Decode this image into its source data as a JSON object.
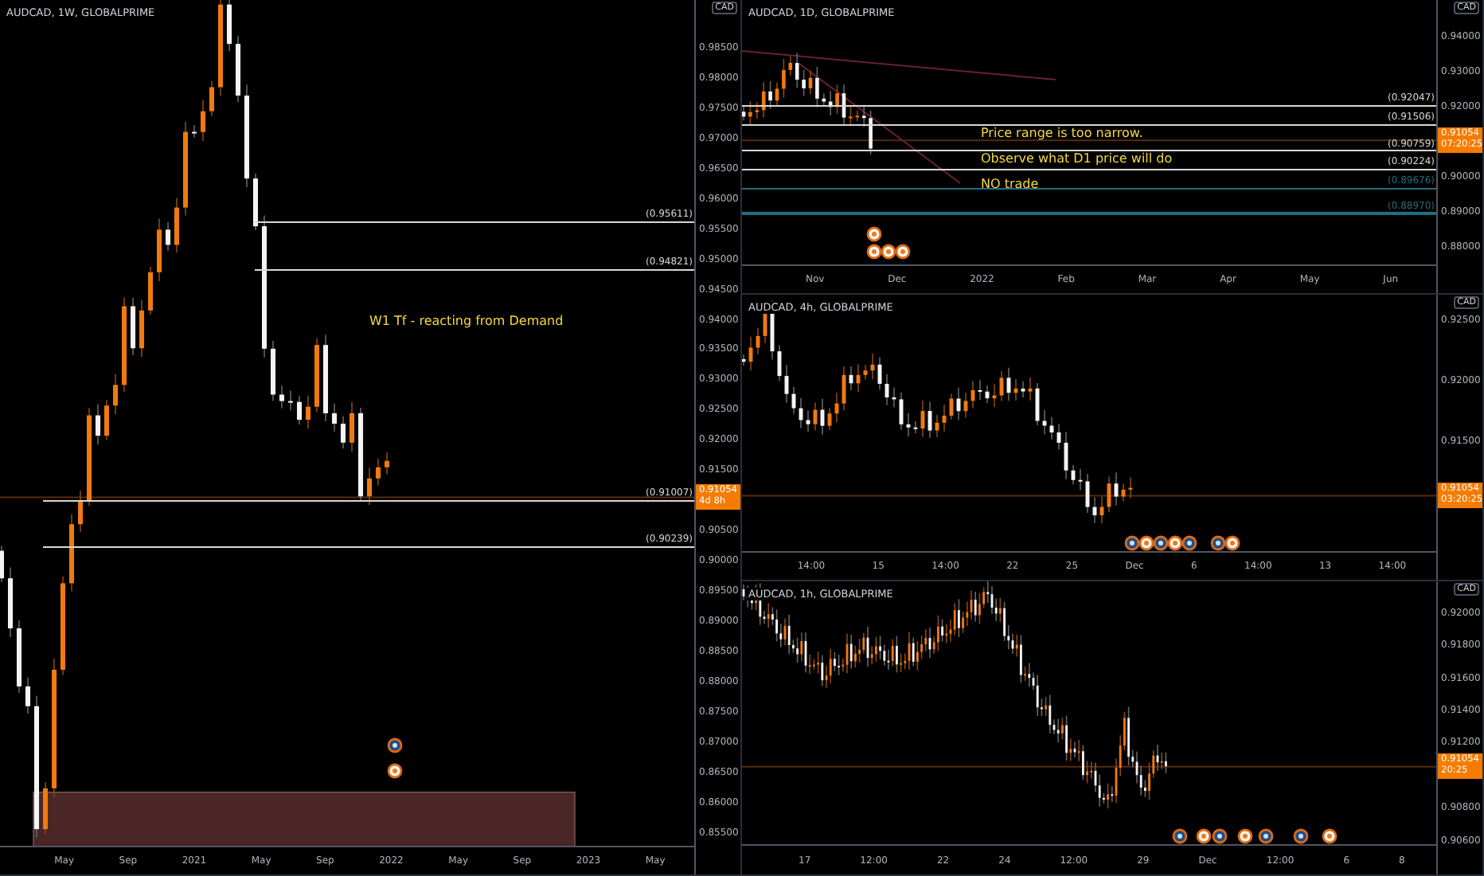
{
  "panels": [
    {
      "title": "AUDCAD, 1W, GLOBALPRIME",
      "currency": "CAD",
      "price_tag": {
        "price": "0.91054",
        "countdown": "4d 8h"
      },
      "y_labels": [
        "0.98500",
        "0.98000",
        "0.97500",
        "0.97000",
        "0.96500",
        "0.96000",
        "0.95500",
        "0.95000",
        "0.94500",
        "0.94000",
        "0.93500",
        "0.93000",
        "0.92500",
        "0.92000",
        "0.91500",
        "0.90500",
        "0.90000",
        "0.89500",
        "0.89000",
        "0.88500",
        "0.88000",
        "0.87500",
        "0.87000",
        "0.86500",
        "0.86000",
        "0.85500"
      ],
      "x_labels": [
        "May",
        "Sep",
        "2021",
        "May",
        "Sep",
        "2022",
        "May",
        "Sep",
        "2023",
        "May"
      ],
      "levels": [
        {
          "label": "(0.95611)",
          "color": "#d8d8d8"
        },
        {
          "label": "(0.94821)",
          "color": "#d8d8d8"
        },
        {
          "label": "(0.91007)",
          "color": "#d8d8d8"
        },
        {
          "label": "(0.90239)",
          "color": "#d8d8d8"
        }
      ],
      "notes": [
        "W1 Tf - reacting from Demand"
      ]
    },
    {
      "title": "AUDCAD, 1D, GLOBALPRIME",
      "currency": "CAD",
      "price_tag": {
        "price": "0.91054",
        "countdown": "07:20:25"
      },
      "y_labels": [
        "0.94000",
        "0.93000",
        "0.92000",
        "0.90000",
        "0.89000",
        "0.88000"
      ],
      "x_labels": [
        "Nov",
        "Dec",
        "2022",
        "Feb",
        "Mar",
        "Apr",
        "May",
        "Jun"
      ],
      "levels": [
        {
          "label": "(0.92047)",
          "color": "#d8d8d8"
        },
        {
          "label": "(0.91506)",
          "color": "#d8d8d8"
        },
        {
          "label": "(0.90759)",
          "color": "#d8d8d8"
        },
        {
          "label": "(0.90224)",
          "color": "#d8d8d8"
        },
        {
          "label": "(0.89676)",
          "color": "#1f6f80"
        },
        {
          "label": "(0.88970)",
          "color": "#1f6f80"
        }
      ],
      "notes": [
        "Price range is too narrow.",
        "Observe what D1 price will do",
        "NO trade"
      ]
    },
    {
      "title": "AUDCAD, 4h, GLOBALPRIME",
      "currency": "CAD",
      "price_tag": {
        "price": "0.91054",
        "countdown": "03:20:25"
      },
      "y_labels": [
        "0.92500",
        "0.92000",
        "0.91500"
      ],
      "x_labels": [
        "14:00",
        "15",
        "14:00",
        "22",
        "25",
        "Dec",
        "6",
        "14:00",
        "13",
        "14:00"
      ]
    },
    {
      "title": "AUDCAD, 1h, GLOBALPRIME",
      "currency": "CAD",
      "price_tag": {
        "price": "0.91054",
        "countdown": "20:25"
      },
      "y_labels": [
        "0.92000",
        "0.91800",
        "0.91600",
        "0.91400",
        "0.91200",
        "0.90800",
        "0.90600"
      ],
      "x_labels": [
        "17",
        "12:00",
        "22",
        "24",
        "12:00",
        "29",
        "Dec",
        "12:00",
        "6",
        "8"
      ]
    }
  ]
}
